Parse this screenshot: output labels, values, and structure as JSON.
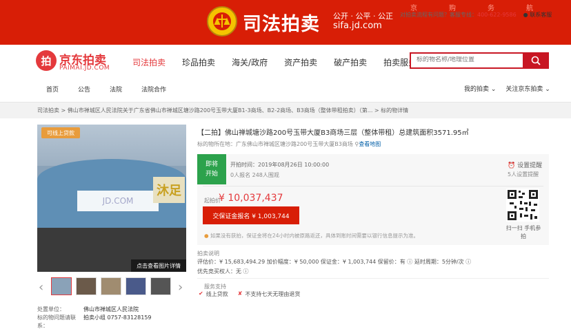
{
  "banner": {
    "title": "司法拍卖",
    "slogan": "公开 · 公平 · 公正",
    "url": "sifa.jd.com",
    "nav": "京购务航"
  },
  "logo": {
    "name": "京东拍卖",
    "domain": "PAIMAI.JD.COM",
    "mark": "拍"
  },
  "mainnav": [
    "司法拍卖",
    "珍品拍卖",
    "海关/政府",
    "资产拍卖",
    "破产拍卖",
    "拍卖服务"
  ],
  "search": {
    "placeholder": "标的物名称/地理位置"
  },
  "subnav": [
    "首页",
    "公告",
    "法院",
    "法院合作"
  ],
  "subnav_right": [
    "我的拍卖 ⌄",
    "关注京东拍卖 ⌄"
  ],
  "breadcrumb": "司法拍卖 > 佛山市禅城区人民法院关于广东省佛山市禅城区塘沙路200号玉带大厦B1-3商场、B2-2商场、B3商场（整体带租拍卖）（第... > 标的物详情",
  "help": {
    "text": "对拍卖流程有问题？客服专线：",
    "tel": "400-622-9586",
    "service": "联系客服"
  },
  "gallery": {
    "badge": "可线上贷款",
    "watermark": "JD.COM",
    "sign": "沐足",
    "all_images": "点击查看图片详情"
  },
  "facts": {
    "unit_label": "处置单位：",
    "unit_value": "佛山市禅城区人民法院",
    "contact_label": "标的物问题请联系：",
    "contact_value": "拍卖小组 0757-83128159"
  },
  "item": {
    "title": "【二拍】佛山禅城塘沙路200号玉带大厦B3商场三层（整体带租）总建筑面积3571.95㎡",
    "location_label": "标的物所在地：",
    "location": "广东佛山市禅城区塘沙路200号玉带大厦B3商场",
    "map_link": "查看地图"
  },
  "auction": {
    "status_1": "即将",
    "status_2": "开始",
    "start_time": "开拍时间：2019年08月26日 10:00:00",
    "counts": "0人报名   248人围观",
    "remind": "设置提醒",
    "remind_count": "5人设置提醒",
    "price_label": "起拍价",
    "price": "¥ 10,037,437",
    "deposit_button": "交保证金报名 ¥ 1,003,744",
    "qr_label": "扫一扫 手机参拍",
    "notice": "如果没有获拍，保证金将在24小时内被原路返还，具体到账时间需要以银行信息提示为准。"
  },
  "info": {
    "heading": "拍卖说明",
    "row1": "评估价：¥ 15,683,494.29   加价幅度：¥ 50,000   保证金：¥ 1,003,744   保留价：有 ⓘ   延时周期：5分钟/次 ⓘ",
    "row2": "优先竞买权人：无 ⓘ"
  },
  "service": {
    "heading": "服务支持",
    "loan": "线上贷款",
    "no_return": "不支持七天无理由退货"
  }
}
